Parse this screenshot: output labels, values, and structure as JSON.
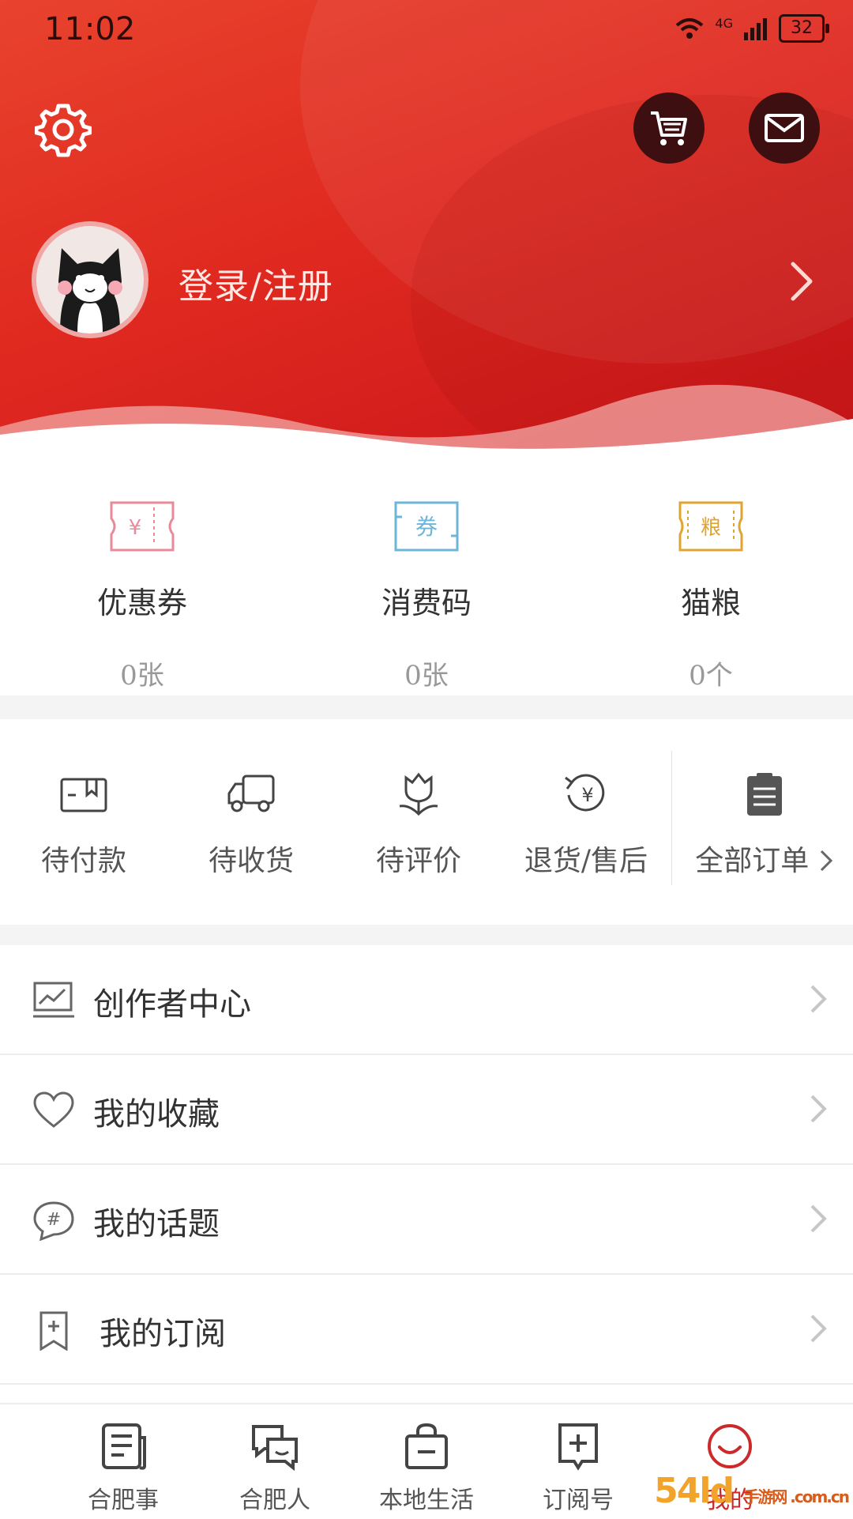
{
  "status_bar": {
    "time": "11:02",
    "network": "4G",
    "battery": "32"
  },
  "header": {
    "login_label": "登录/注册"
  },
  "wallet": [
    {
      "label": "优惠券",
      "value": "0张",
      "icon_text": "¥",
      "icon": "coupon-ticket-icon",
      "color": "#e98a9a"
    },
    {
      "label": "消费码",
      "value": "0张",
      "icon_text": "券",
      "icon": "consume-code-icon",
      "color": "#6cb6d8"
    },
    {
      "label": "猫粮",
      "value": "0个",
      "icon_text": "粮",
      "icon": "cat-food-icon",
      "color": "#e0a431"
    }
  ],
  "orders": [
    {
      "label": "待付款",
      "icon": "wallet-icon"
    },
    {
      "label": "待收货",
      "icon": "truck-icon"
    },
    {
      "label": "待评价",
      "icon": "flower-icon"
    },
    {
      "label": "退货/售后",
      "icon": "refund-icon"
    },
    {
      "label": "全部订单",
      "icon": "clipboard-icon"
    }
  ],
  "menu": [
    {
      "label": "创作者中心",
      "icon": "creator-chart-icon"
    },
    {
      "label": "我的收藏",
      "icon": "heart-icon"
    },
    {
      "label": "我的话题",
      "icon": "hashtag-icon"
    },
    {
      "label": "我的订阅",
      "icon": "bookmark-add-icon"
    }
  ],
  "tabbar": [
    {
      "label": "合肥事",
      "icon": "news-icon",
      "active": false
    },
    {
      "label": "合肥人",
      "icon": "chat-icon",
      "active": false
    },
    {
      "label": "本地生活",
      "icon": "shopping-bag-icon",
      "active": false
    },
    {
      "label": "订阅号",
      "icon": "subscribe-icon",
      "active": false
    },
    {
      "label": "我的",
      "icon": "smile-icon",
      "active": true
    }
  ],
  "watermark": {
    "text": "54ld",
    "sub": "手游网 .com.cn"
  },
  "colors": {
    "brand_red": "#e02a20",
    "active_tab": "#cc2a2a"
  }
}
